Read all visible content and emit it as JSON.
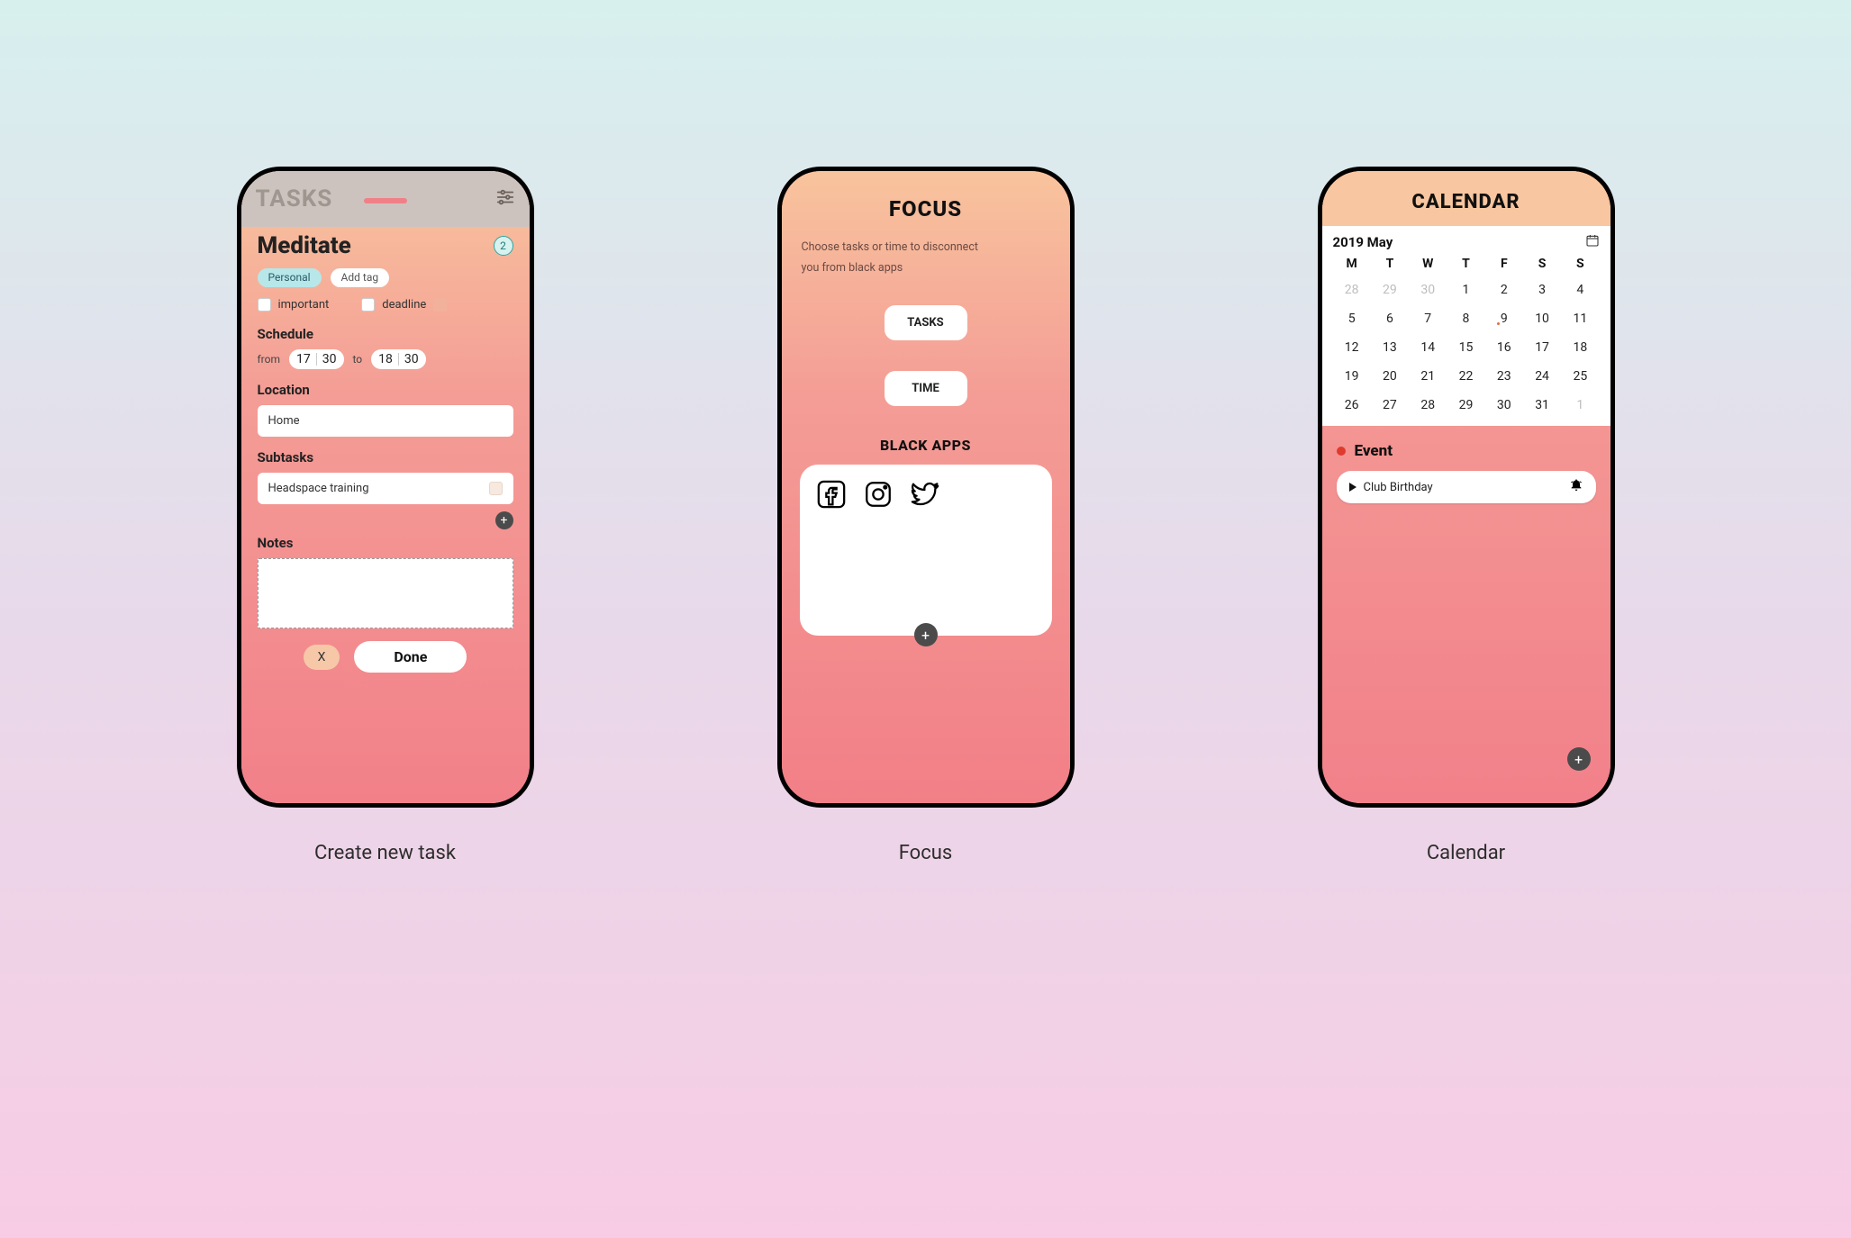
{
  "captions": {
    "screen1": "Create new task",
    "screen2": "Focus",
    "screen3": "Calendar"
  },
  "screen1": {
    "header_title": "TASKS",
    "task_title": "Meditate",
    "badge_count": "2",
    "tags": {
      "personal": "Personal",
      "add": "Add tag"
    },
    "flags": {
      "important": "important",
      "deadline": "deadline"
    },
    "sections": {
      "schedule": "Schedule",
      "location": "Location",
      "subtasks": "Subtasks",
      "notes": "Notes"
    },
    "schedule": {
      "from_label": "from",
      "to_label": "to",
      "from_h": "17",
      "from_m": "30",
      "to_h": "18",
      "to_m": "30"
    },
    "location_value": "Home",
    "subtask_value": "Headspace training",
    "buttons": {
      "cancel": "X",
      "done": "Done"
    }
  },
  "screen2": {
    "title": "FOCUS",
    "subtitle_line1": "Choose tasks or time to disconnect",
    "subtitle_line2": "you from black apps",
    "buttons": {
      "tasks": "TASKS",
      "time": "TIME"
    },
    "black_apps_title": "BLACK APPS",
    "apps": [
      "facebook",
      "instagram",
      "twitter"
    ]
  },
  "screen3": {
    "title": "CALENDAR",
    "year": "2019",
    "month": "May",
    "dow": [
      "M",
      "T",
      "W",
      "T",
      "F",
      "S",
      "S"
    ],
    "days": [
      {
        "d": "28",
        "other": true
      },
      {
        "d": "29",
        "other": true
      },
      {
        "d": "30",
        "other": true
      },
      {
        "d": "1"
      },
      {
        "d": "2"
      },
      {
        "d": "3",
        "today": true
      },
      {
        "d": "4"
      },
      {
        "d": "5"
      },
      {
        "d": "6"
      },
      {
        "d": "7"
      },
      {
        "d": "8"
      },
      {
        "d": "9",
        "sel": true,
        "dot": true
      },
      {
        "d": "10"
      },
      {
        "d": "11"
      },
      {
        "d": "12"
      },
      {
        "d": "13"
      },
      {
        "d": "14"
      },
      {
        "d": "15"
      },
      {
        "d": "16"
      },
      {
        "d": "17"
      },
      {
        "d": "18"
      },
      {
        "d": "19"
      },
      {
        "d": "20"
      },
      {
        "d": "21"
      },
      {
        "d": "22"
      },
      {
        "d": "23"
      },
      {
        "d": "24"
      },
      {
        "d": "25"
      },
      {
        "d": "26"
      },
      {
        "d": "27"
      },
      {
        "d": "28"
      },
      {
        "d": "29"
      },
      {
        "d": "30"
      },
      {
        "d": "31"
      },
      {
        "d": "1",
        "other": true
      }
    ],
    "event_header": "Event",
    "event_name": "Club Birthday"
  },
  "colors": {
    "personal_tag": "#b7e7e9",
    "gradient_top": "#f8c49d",
    "gradient_bottom": "#f28089",
    "badge_ring": "#2aa8a1"
  }
}
